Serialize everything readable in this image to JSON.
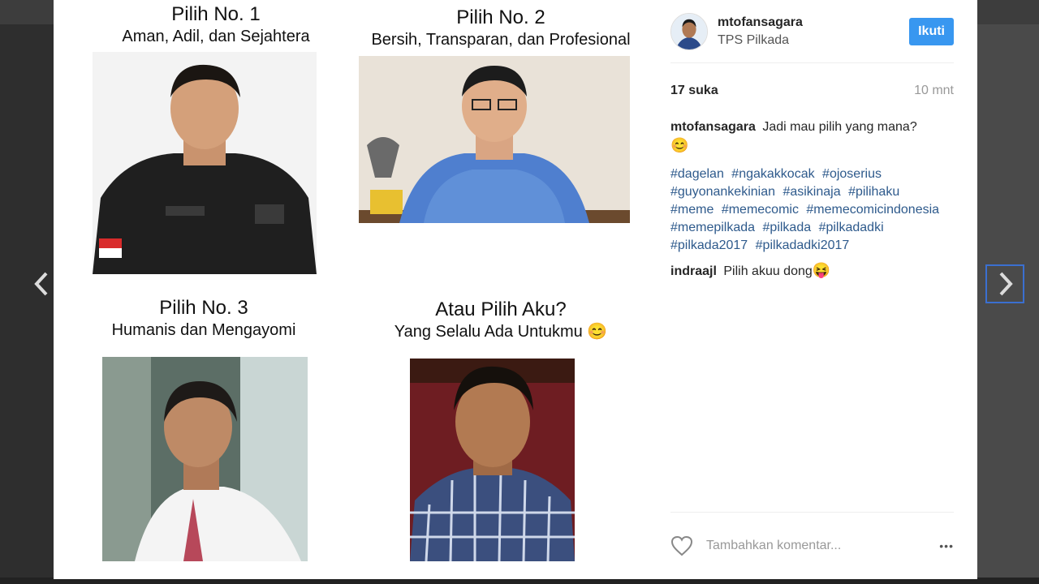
{
  "post": {
    "meme": {
      "cells": [
        {
          "title": "Pilih No. 1",
          "subtitle": "Aman, Adil, dan Sejahtera"
        },
        {
          "title": "Pilih No. 2",
          "subtitle": "Bersih, Transparan, dan Profesional"
        },
        {
          "title": "Pilih No. 3",
          "subtitle": "Humanis dan Mengayomi"
        },
        {
          "title": "Atau Pilih Aku?",
          "subtitle": "Yang Selalu Ada Untukmu 😊"
        }
      ]
    }
  },
  "sidebar": {
    "username": "mtofansagara",
    "location": "TPS Pilkada",
    "follow_label": "Ikuti",
    "likes": "17 suka",
    "time": "10 mnt",
    "caption": {
      "user": "mtofansagara",
      "text": "Jadi mau pilih yang mana?",
      "emoji": "😊"
    },
    "hashtags": [
      "#dagelan",
      "#ngakakkocak",
      "#ojoserius",
      "#guyonankekinian",
      "#asikinaja",
      "#pilihaku",
      "#meme",
      "#memecomic",
      "#memecomicindonesia",
      "#memepilkada",
      "#pilkada",
      "#pilkadadki",
      "#pilkada2017",
      "#pilkadadki2017"
    ],
    "comments": [
      {
        "user": "indraajl",
        "text": "Pilih akuu dong",
        "emoji": "😝"
      }
    ],
    "comment_placeholder": "Tambahkan komentar...",
    "more_label": "•••"
  },
  "icons": {
    "prev": "chevron-left-icon",
    "next": "chevron-right-icon",
    "like": "heart-icon"
  },
  "colors": {
    "follow_button": "#3897f0",
    "hashtag": "#2e5a8c",
    "next_focus_border": "#3b6fd0"
  }
}
